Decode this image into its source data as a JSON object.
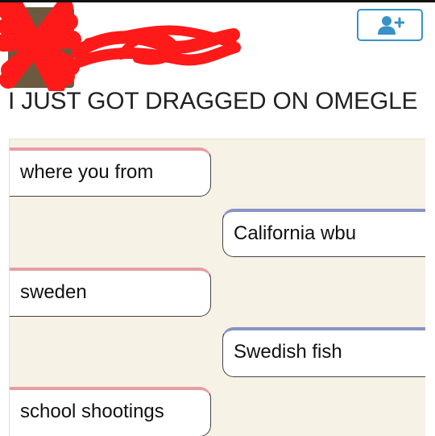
{
  "post": {
    "title": "I JUST GOT DRAGGED ON OMEGLE"
  },
  "header": {
    "follow_icon": "add-user-icon",
    "accent_color": "#3a91c7",
    "redaction_color": "#ff1a1a"
  },
  "chat": {
    "messages": [
      {
        "sender": "stranger",
        "text": "where you from"
      },
      {
        "sender": "you",
        "text": "California wbu"
      },
      {
        "sender": "stranger",
        "text": "sweden"
      },
      {
        "sender": "you",
        "text": "Swedish fish"
      },
      {
        "sender": "stranger",
        "text": "school shootings"
      }
    ],
    "stranger_accent": "#e79ea3",
    "you_accent": "#8993c4",
    "background": "#f6f2e6"
  }
}
